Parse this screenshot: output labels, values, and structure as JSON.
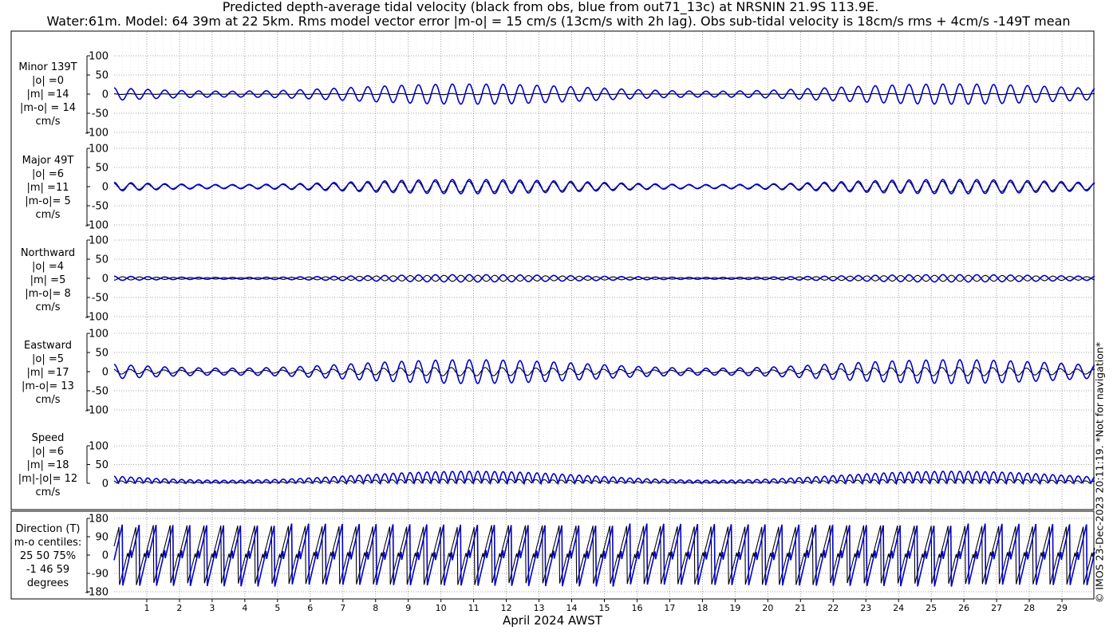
{
  "header": {
    "title_line1": "Predicted depth-average tidal velocity (black from obs, blue from out71_13c) at NRSNIN 21.9S 113.9E.",
    "title_line2": "Water:61m. Model: 64 39m at 22 5km. Rms model vector error |m-o| = 15 cm/s (13cm/s with 2h lag). Obs sub-tidal velocity is 18cm/s rms + 4cm/s -149T mean"
  },
  "side_note": "© IMOS 23-Dec-2023 20:11:19. *Not for navigation*",
  "colors": {
    "obs": "#000000",
    "model": "#0000cc",
    "grid": "#888888",
    "frame": "#000000"
  },
  "chart_data": {
    "type": "line",
    "xlabel": "April 2024 AWST",
    "x_ticks": [
      "1",
      "2",
      "3",
      "4",
      "5",
      "6",
      "7",
      "8",
      "9",
      "10",
      "11",
      "12",
      "13",
      "14",
      "15",
      "16",
      "17",
      "18",
      "19",
      "20",
      "21",
      "22",
      "23",
      "24",
      "25",
      "26",
      "27",
      "28",
      "29"
    ],
    "x_range_days": [
      0.0,
      30.0
    ],
    "tidal_period_hours": 12.42,
    "spring_neap_days": 14.77,
    "panels": [
      {
        "id": "minor",
        "label_lines": [
          "Minor 139T",
          "|o| =0",
          "|m| =14",
          "|m-o| = 14",
          "cm/s"
        ],
        "yticks": [
          "100",
          "50",
          "0",
          "-50",
          "-100"
        ],
        "ylim": [
          -100,
          100
        ],
        "series": [
          {
            "role": "obs",
            "amp_mean": 1,
            "amp_var": 0.5,
            "phase": 0.3
          },
          {
            "role": "model",
            "amp_mean": 17,
            "amp_var": 0.55,
            "phase": 0.0
          }
        ]
      },
      {
        "id": "major",
        "label_lines": [
          "Major 49T",
          "|o| =6",
          "|m| =11",
          "|m-o|= 5",
          "cm/s"
        ],
        "yticks": [
          "100",
          "50",
          "0",
          "-50",
          "-100"
        ],
        "ylim": [
          -100,
          100
        ],
        "series": [
          {
            "role": "obs",
            "amp_mean": 9,
            "amp_var": 0.55,
            "phase": 0.2
          },
          {
            "role": "model",
            "amp_mean": 12,
            "amp_var": 0.55,
            "phase": 0.0
          }
        ]
      },
      {
        "id": "north",
        "label_lines": [
          "Northward",
          "|o| =4",
          "|m| =5",
          "|m-o|= 8",
          "cm/s"
        ],
        "yticks": [
          "100",
          "50",
          "0",
          "-50",
          "-100"
        ],
        "ylim": [
          -100,
          100
        ],
        "series": [
          {
            "role": "obs",
            "amp_mean": 5,
            "amp_var": 0.6,
            "phase": 3.1
          },
          {
            "role": "model",
            "amp_mean": 6,
            "amp_var": 0.6,
            "phase": 0.0
          }
        ]
      },
      {
        "id": "east",
        "label_lines": [
          "Eastward",
          "|o| =5",
          "|m| =17",
          "|m-o|= 13",
          "cm/s"
        ],
        "yticks": [
          "100",
          "50",
          "0",
          "-50",
          "-100"
        ],
        "ylim": [
          -100,
          100
        ],
        "series": [
          {
            "role": "obs",
            "amp_mean": 7,
            "amp_var": 0.55,
            "phase": 0.4
          },
          {
            "role": "model",
            "amp_mean": 20,
            "amp_var": 0.55,
            "phase": 0.0
          }
        ]
      },
      {
        "id": "speed",
        "label_lines": [
          "Speed",
          "|o| =6",
          "|m| =18",
          "|m|-|o|= 12",
          "cm/s"
        ],
        "yticks": [
          "100",
          "50",
          "0"
        ],
        "ylim": [
          0,
          100
        ],
        "series": [
          {
            "role": "obs",
            "amp_mean": 7,
            "amp_var": 0.6,
            "phase": 0.4
          },
          {
            "role": "model",
            "amp_mean": 20,
            "amp_var": 0.6,
            "phase": 0.0
          }
        ]
      },
      {
        "id": "direction",
        "label_lines": [
          "Direction (T)",
          "m-o centiles:",
          "25  50  75%",
          "-1  46  59",
          "degrees"
        ],
        "yticks": [
          "180",
          "90",
          "0",
          "-90",
          "-180"
        ],
        "ylim": [
          -180,
          180
        ],
        "series": [
          {
            "role": "obs"
          },
          {
            "role": "model"
          }
        ]
      }
    ]
  }
}
